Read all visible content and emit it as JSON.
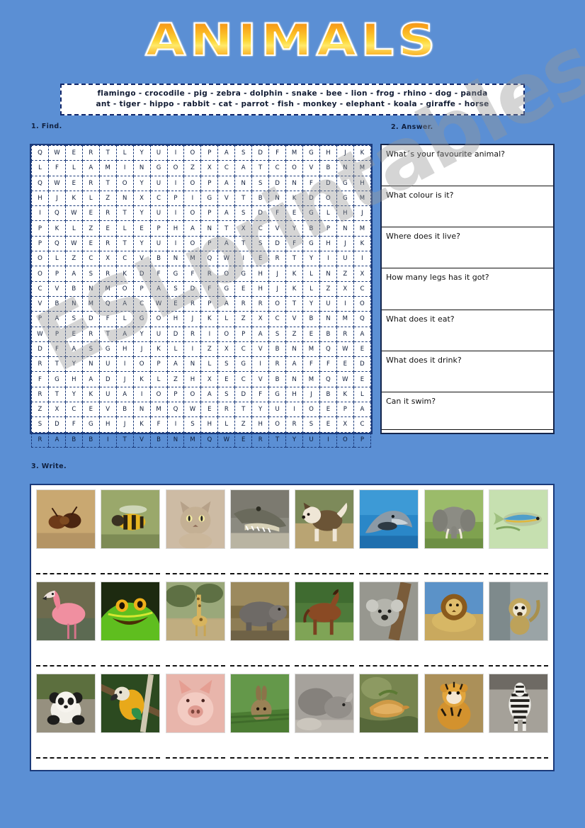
{
  "page": {
    "background_color": "#5b8fd4",
    "title": "ANIMALS",
    "title_gradient_from": "#f08a1c",
    "title_gradient_to": "#fdd535",
    "watermark": "ESLprintables.com"
  },
  "word_bank": {
    "line1": "flamingo - crocodile - pig - zebra - dolphin - snake - bee - lion - frog - rhino - dog - panda",
    "line2": "ant - tiger - hippo - rabbit - cat - parrot - fish - monkey - elephant - koala - giraffe - horse",
    "words": [
      "flamingo",
      "crocodile",
      "pig",
      "zebra",
      "dolphin",
      "snake",
      "bee",
      "lion",
      "frog",
      "rhino",
      "dog",
      "panda",
      "ant",
      "tiger",
      "hippo",
      "rabbit",
      "cat",
      "parrot",
      "fish",
      "monkey",
      "elephant",
      "koala",
      "giraffe",
      "horse"
    ]
  },
  "sections": {
    "find": "1.  Find.",
    "answer": "2.  Answer.",
    "write": "3.  Write."
  },
  "word_search": {
    "rows": 20,
    "cols": 20,
    "grid": [
      [
        "Q",
        "W",
        "E",
        "R",
        "T",
        "L",
        "Y",
        "U",
        "I",
        "O",
        "P",
        "A",
        "S",
        "D",
        "F",
        "M",
        "G",
        "H",
        "J",
        "K"
      ],
      [
        "L",
        "F",
        "L",
        "A",
        "M",
        "I",
        "N",
        "G",
        "O",
        "Z",
        "X",
        "C",
        "A",
        "T",
        "C",
        "O",
        "V",
        "B",
        "N",
        "M"
      ],
      [
        "Q",
        "W",
        "E",
        "R",
        "T",
        "O",
        "Y",
        "U",
        "I",
        "O",
        "P",
        "A",
        "N",
        "S",
        "D",
        "N",
        "F",
        "D",
        "G",
        "H"
      ],
      [
        "H",
        "J",
        "K",
        "L",
        "Z",
        "N",
        "X",
        "C",
        "P",
        "I",
        "G",
        "V",
        "T",
        "B",
        "N",
        "K",
        "D",
        "O",
        "G",
        "M"
      ],
      [
        "I",
        "Q",
        "W",
        "E",
        "R",
        "T",
        "Y",
        "U",
        "I",
        "O",
        "P",
        "A",
        "S",
        "D",
        "F",
        "E",
        "G",
        "L",
        "H",
        "J"
      ],
      [
        "P",
        "K",
        "L",
        "Z",
        "E",
        "L",
        "E",
        "P",
        "H",
        "A",
        "N",
        "T",
        "X",
        "C",
        "V",
        "Y",
        "B",
        "P",
        "N",
        "M"
      ],
      [
        "P",
        "Q",
        "W",
        "E",
        "R",
        "T",
        "Y",
        "U",
        "I",
        "O",
        "P",
        "A",
        "T",
        "S",
        "D",
        "F",
        "G",
        "H",
        "J",
        "K"
      ],
      [
        "O",
        "L",
        "Z",
        "C",
        "X",
        "C",
        "V",
        "B",
        "N",
        "M",
        "Q",
        "W",
        "I",
        "E",
        "R",
        "T",
        "Y",
        "I",
        "U",
        "I"
      ],
      [
        "O",
        "P",
        "A",
        "S",
        "R",
        "K",
        "D",
        "F",
        "G",
        "F",
        "R",
        "O",
        "G",
        "H",
        "J",
        "K",
        "L",
        "N",
        "Z",
        "X"
      ],
      [
        "C",
        "V",
        "B",
        "N",
        "M",
        "O",
        "P",
        "A",
        "S",
        "D",
        "F",
        "G",
        "E",
        "H",
        "J",
        "K",
        "L",
        "Z",
        "X",
        "C"
      ],
      [
        "V",
        "B",
        "N",
        "M",
        "Q",
        "A",
        "C",
        "W",
        "E",
        "R",
        "P",
        "A",
        "R",
        "R",
        "O",
        "T",
        "Y",
        "U",
        "I",
        "O"
      ],
      [
        "P",
        "A",
        "S",
        "D",
        "F",
        "L",
        "G",
        "O",
        "H",
        "J",
        "K",
        "L",
        "Z",
        "X",
        "C",
        "V",
        "B",
        "N",
        "M",
        "Q"
      ],
      [
        "W",
        "P",
        "E",
        "R",
        "T",
        "A",
        "Y",
        "U",
        "D",
        "R",
        "I",
        "O",
        "P",
        "A",
        "S",
        "Z",
        "E",
        "B",
        "R",
        "A"
      ],
      [
        "D",
        "F",
        "A",
        "S",
        "G",
        "H",
        "J",
        "K",
        "L",
        "I",
        "Z",
        "X",
        "C",
        "V",
        "B",
        "N",
        "M",
        "Q",
        "W",
        "E"
      ],
      [
        "R",
        "T",
        "Y",
        "N",
        "U",
        "I",
        "O",
        "P",
        "A",
        "N",
        "L",
        "S",
        "G",
        "I",
        "R",
        "A",
        "F",
        "F",
        "E",
        "D"
      ],
      [
        "F",
        "G",
        "H",
        "A",
        "D",
        "J",
        "K",
        "L",
        "Z",
        "H",
        "X",
        "E",
        "C",
        "V",
        "B",
        "N",
        "M",
        "Q",
        "W",
        "E"
      ],
      [
        "R",
        "T",
        "Y",
        "K",
        "U",
        "A",
        "I",
        "O",
        "P",
        "O",
        "A",
        "S",
        "D",
        "F",
        "G",
        "H",
        "J",
        "B",
        "K",
        "L"
      ],
      [
        "Z",
        "X",
        "C",
        "E",
        "V",
        "B",
        "N",
        "M",
        "Q",
        "W",
        "E",
        "R",
        "T",
        "Y",
        "U",
        "I",
        "O",
        "E",
        "P",
        "A"
      ],
      [
        "S",
        "D",
        "F",
        "G",
        "H",
        "J",
        "K",
        "F",
        "I",
        "S",
        "H",
        "L",
        "Z",
        "H",
        "O",
        "R",
        "S",
        "E",
        "X",
        "C"
      ],
      [
        "R",
        "A",
        "B",
        "B",
        "I",
        "T",
        "V",
        "B",
        "N",
        "M",
        "Q",
        "W",
        "E",
        "R",
        "T",
        "Y",
        "U",
        "I",
        "O",
        "P"
      ]
    ]
  },
  "questions": [
    "What´s your favourite animal?",
    "What colour is it?",
    "Where does it live?",
    "How many legs has it got?",
    "What does it eat?",
    "What does it drink?",
    "Can it swim?"
  ],
  "picture_grid": {
    "rows": 3,
    "cols": 8,
    "answer_line_placeholder": "_ _ _ _ _ _ _ _ _ _",
    "cells": [
      [
        {
          "animal": "ant",
          "icon": "ant-photo"
        },
        {
          "animal": "bee",
          "icon": "bee-photo"
        },
        {
          "animal": "cat",
          "icon": "cat-photo"
        },
        {
          "animal": "crocodile",
          "icon": "crocodile-photo"
        },
        {
          "animal": "dog",
          "icon": "dog-photo"
        },
        {
          "animal": "dolphin",
          "icon": "dolphin-photo"
        },
        {
          "animal": "elephant",
          "icon": "elephant-photo"
        },
        {
          "animal": "fish",
          "icon": "fish-photo"
        }
      ],
      [
        {
          "animal": "flamingo",
          "icon": "flamingo-photo"
        },
        {
          "animal": "frog",
          "icon": "frog-photo"
        },
        {
          "animal": "giraffe",
          "icon": "giraffe-photo"
        },
        {
          "animal": "hippo",
          "icon": "hippo-photo"
        },
        {
          "animal": "horse",
          "icon": "horse-photo"
        },
        {
          "animal": "koala",
          "icon": "koala-photo"
        },
        {
          "animal": "lion",
          "icon": "lion-photo"
        },
        {
          "animal": "monkey",
          "icon": "monkey-photo"
        }
      ],
      [
        {
          "animal": "panda",
          "icon": "panda-photo"
        },
        {
          "animal": "parrot",
          "icon": "parrot-photo"
        },
        {
          "animal": "pig",
          "icon": "pig-photo"
        },
        {
          "animal": "rabbit",
          "icon": "rabbit-photo"
        },
        {
          "animal": "rhino",
          "icon": "rhino-photo"
        },
        {
          "animal": "snake",
          "icon": "snake-photo"
        },
        {
          "animal": "tiger",
          "icon": "tiger-photo"
        },
        {
          "animal": "zebra",
          "icon": "zebra-photo"
        }
      ]
    ]
  }
}
